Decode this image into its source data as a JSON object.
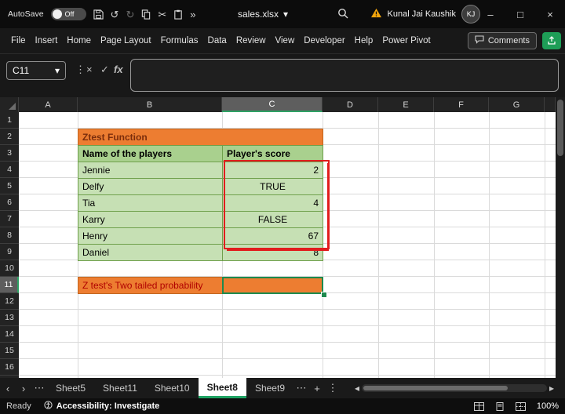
{
  "titlebar": {
    "autosave_label": "AutoSave",
    "autosave_state": "Off",
    "filename": "sales.xlsx",
    "user_name": "Kunal Jai Kaushik",
    "user_initials": "KJ"
  },
  "icons": {
    "undo": "↺",
    "redo": "↻",
    "scissors": "✂",
    "more": "»",
    "caret_down": "▾",
    "dots_v": "⋮",
    "dots_h": "⋯",
    "nav_left": "‹",
    "nav_right": "›",
    "plus": "+",
    "scroll_left": "◂",
    "scroll_right": "▸",
    "minimize": "–",
    "maximize": "□",
    "close": "×",
    "cancel": "×",
    "check": "✓"
  },
  "ribbon": {
    "tabs": [
      "File",
      "Insert",
      "Home",
      "Page Layout",
      "Formulas",
      "Data",
      "Review",
      "View",
      "Developer",
      "Help",
      "Power Pivot"
    ],
    "comments_label": "Comments"
  },
  "formula_bar": {
    "name_box": "C11",
    "fx_label": "fx"
  },
  "grid": {
    "columns": [
      "A",
      "B",
      "C",
      "D",
      "E",
      "F",
      "G"
    ],
    "rows": [
      "1",
      "2",
      "3",
      "4",
      "5",
      "6",
      "7",
      "8",
      "9",
      "10",
      "11",
      "12",
      "13",
      "14",
      "15",
      "16"
    ],
    "selected_cell": "C11",
    "selected_column": "C",
    "selected_row": "11"
  },
  "sheet_content": {
    "title": "Ztest Function",
    "headers": [
      "Name of the players",
      "Player's score"
    ],
    "rows": [
      {
        "name": "Jennie",
        "score": "2"
      },
      {
        "name": "Delfy",
        "score": "TRUE"
      },
      {
        "name": "Tia",
        "score": "4"
      },
      {
        "name": "Karry",
        "score": "FALSE"
      },
      {
        "name": "Henry",
        "score": "67"
      },
      {
        "name": "Daniel",
        "score": "8"
      }
    ],
    "label_b11": "Z test's Two tailed probability"
  },
  "sheet_tabs": {
    "tabs": [
      "Sheet5",
      "Sheet11",
      "Sheet10",
      "Sheet8",
      "Sheet9"
    ],
    "active": "Sheet8"
  },
  "status_bar": {
    "ready_label": "Ready",
    "accessibility_label": "Accessibility: Investigate",
    "zoom_level": "100%"
  },
  "colors": {
    "accent_green": "#1fa463",
    "table_orange": "#ed7d31",
    "table_green_light": "#c6e0b4",
    "table_green_header": "#a9d08e",
    "highlight_red": "#e11d1d",
    "titlebar_bg": "#0c0c0c"
  }
}
